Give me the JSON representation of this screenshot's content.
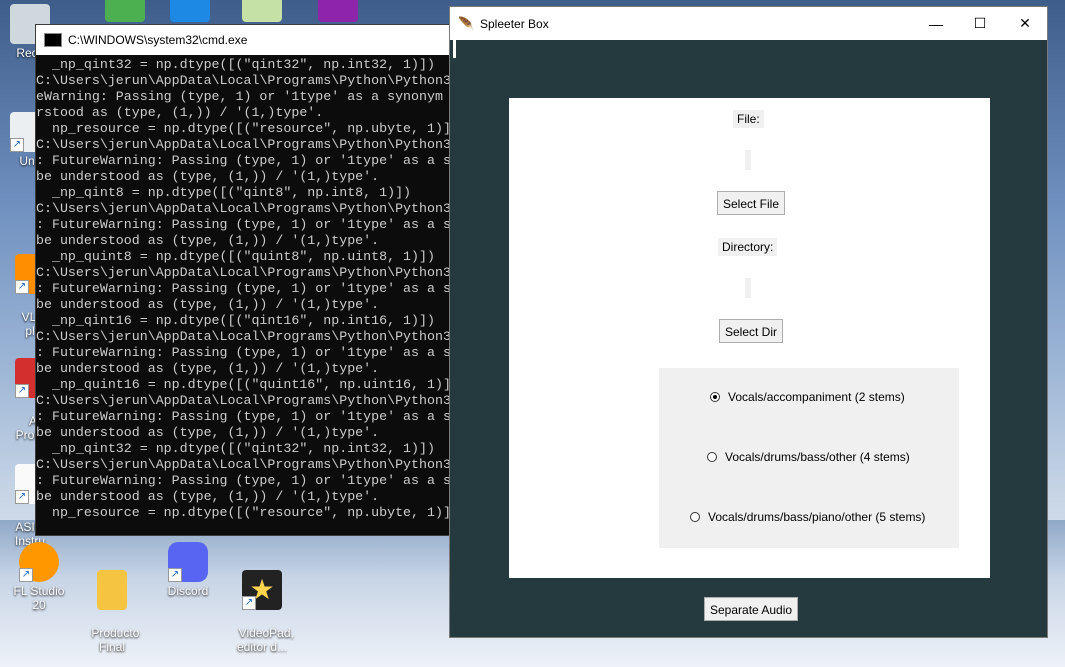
{
  "desktop_icons": [
    {
      "name": "recycle-bin",
      "label": "Recy"
    },
    {
      "name": "unity",
      "label": "Unit"
    },
    {
      "name": "vlc",
      "label": "VLC\npl"
    },
    {
      "name": "adobe",
      "label": "A\nProfe"
    },
    {
      "name": "asio",
      "label": "ASIO4\nInstru"
    },
    {
      "name": "fl-studio",
      "label": "FL Studio 20"
    },
    {
      "name": "producto-final",
      "label": "Producto\nFinal"
    },
    {
      "name": "discord",
      "label": "Discord"
    },
    {
      "name": "videopad",
      "label": "VideoPad,\neditor d..."
    }
  ],
  "cmd": {
    "title": "C:\\WINDOWS\\system32\\cmd.exe",
    "lines": [
      "  _np_qint32 = np.dtype([(\"qint32\", np.int32, 1)])",
      "C:\\Users\\jerun\\AppData\\Local\\Programs\\Python\\Python3",
      "eWarning: Passing (type, 1) or '1type' as a synonym",
      "rstood as (type, (1,)) / '(1,)type'.",
      "  np_resource = np.dtype([(\"resource\", np.ubyte, 1)]",
      "C:\\Users\\jerun\\AppData\\Local\\Programs\\Python\\Python3",
      ": FutureWarning: Passing (type, 1) or '1type' as a s",
      "be understood as (type, (1,)) / '(1,)type'.",
      "  _np_qint8 = np.dtype([(\"qint8\", np.int8, 1)])",
      "C:\\Users\\jerun\\AppData\\Local\\Programs\\Python\\Python3",
      ": FutureWarning: Passing (type, 1) or '1type' as a s",
      "be understood as (type, (1,)) / '(1,)type'.",
      "  _np_quint8 = np.dtype([(\"quint8\", np.uint8, 1)])",
      "C:\\Users\\jerun\\AppData\\Local\\Programs\\Python\\Python3",
      ": FutureWarning: Passing (type, 1) or '1type' as a s",
      "be understood as (type, (1,)) / '(1,)type'.",
      "  _np_qint16 = np.dtype([(\"qint16\", np.int16, 1)])",
      "C:\\Users\\jerun\\AppData\\Local\\Programs\\Python\\Python3",
      ": FutureWarning: Passing (type, 1) or '1type' as a s",
      "be understood as (type, (1,)) / '(1,)type'.",
      "  _np_quint16 = np.dtype([(\"quint16\", np.uint16, 1)]",
      "C:\\Users\\jerun\\AppData\\Local\\Programs\\Python\\Python3",
      ": FutureWarning: Passing (type, 1) or '1type' as a s",
      "be understood as (type, (1,)) / '(1,)type'.",
      "  _np_qint32 = np.dtype([(\"qint32\", np.int32, 1)])",
      "C:\\Users\\jerun\\AppData\\Local\\Programs\\Python\\Python3",
      ": FutureWarning: Passing (type, 1) or '1type' as a s",
      "be understood as (type, (1,)) / '(1,)type'.",
      "  np_resource = np.dtype([(\"resource\", np.ubyte, 1)]"
    ]
  },
  "app": {
    "title": "Spleeter Box",
    "minimize": "—",
    "maximize": "☐",
    "close": "✕",
    "file_label": "File:",
    "select_file": "Select File",
    "directory_label": "Directory:",
    "select_dir": "Select Dir",
    "options": [
      {
        "label": "Vocals/accompaniment (2 stems)",
        "selected": true
      },
      {
        "label": "Vocals/drums/bass/other (4 stems)",
        "selected": false
      },
      {
        "label": "Vocals/drums/bass/piano/other (5 stems)",
        "selected": false
      }
    ],
    "separate": "Separate Audio",
    "bg_color": "#243a3e"
  }
}
